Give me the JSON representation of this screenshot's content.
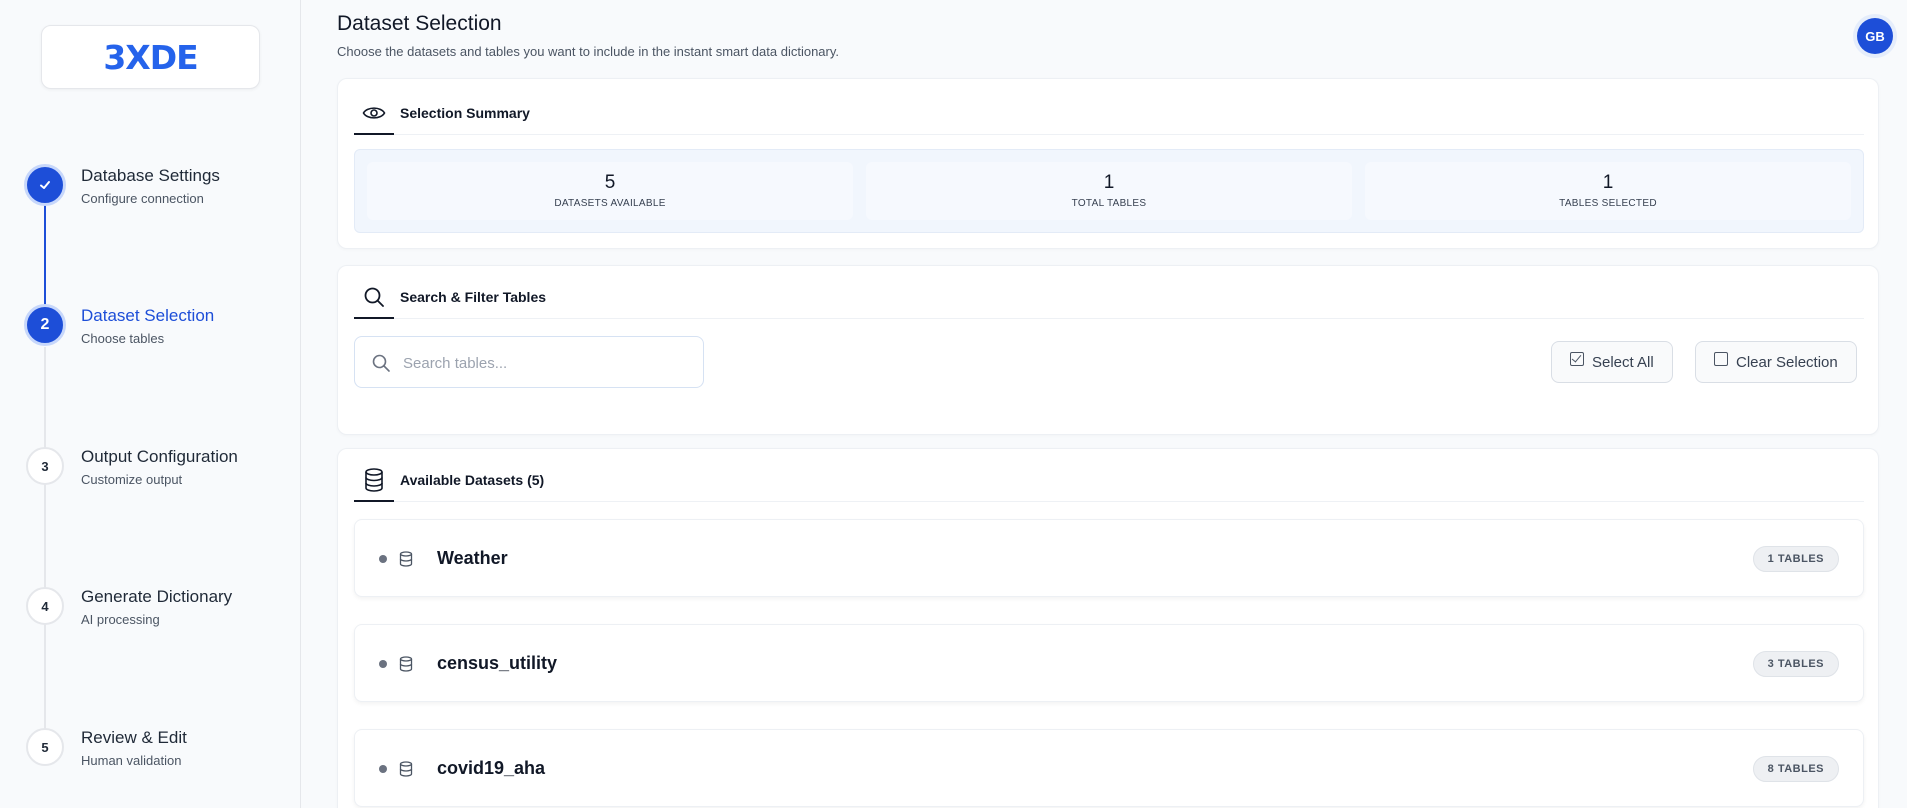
{
  "app": {
    "logo": "3XDE"
  },
  "steps": [
    {
      "number": "✓",
      "title": "Database Settings",
      "subtitle": "Configure connection",
      "state": "done"
    },
    {
      "number": "2",
      "title": "Dataset Selection",
      "subtitle": "Choose tables",
      "state": "active"
    },
    {
      "number": "3",
      "title": "Output Configuration",
      "subtitle": "Customize output",
      "state": "todo"
    },
    {
      "number": "4",
      "title": "Generate Dictionary",
      "subtitle": "AI processing",
      "state": "todo"
    },
    {
      "number": "5",
      "title": "Review & Edit",
      "subtitle": "Human validation",
      "state": "todo"
    }
  ],
  "header": {
    "title": "Dataset Selection",
    "subtitle": "Choose the datasets and tables you want to include in the instant smart data dictionary.",
    "avatar_initials": "GB"
  },
  "summary": {
    "title": "Selection Summary",
    "stats": [
      {
        "value": "5",
        "label": "DATASETS AVAILABLE"
      },
      {
        "value": "1",
        "label": "TOTAL TABLES"
      },
      {
        "value": "1",
        "label": "TABLES SELECTED"
      }
    ]
  },
  "filter": {
    "title": "Search & Filter Tables",
    "search_placeholder": "Search tables...",
    "select_all_label": "Select All",
    "clear_selection_label": "Clear Selection"
  },
  "datasets": {
    "title": "Available Datasets (5)",
    "items": [
      {
        "name": "Weather",
        "badge": "1 TABLES"
      },
      {
        "name": "census_utility",
        "badge": "3 TABLES"
      },
      {
        "name": "covid19_aha",
        "badge": "8 TABLES"
      }
    ]
  },
  "colors": {
    "accent": "#1d4ed8",
    "logo": "#2563eb"
  }
}
